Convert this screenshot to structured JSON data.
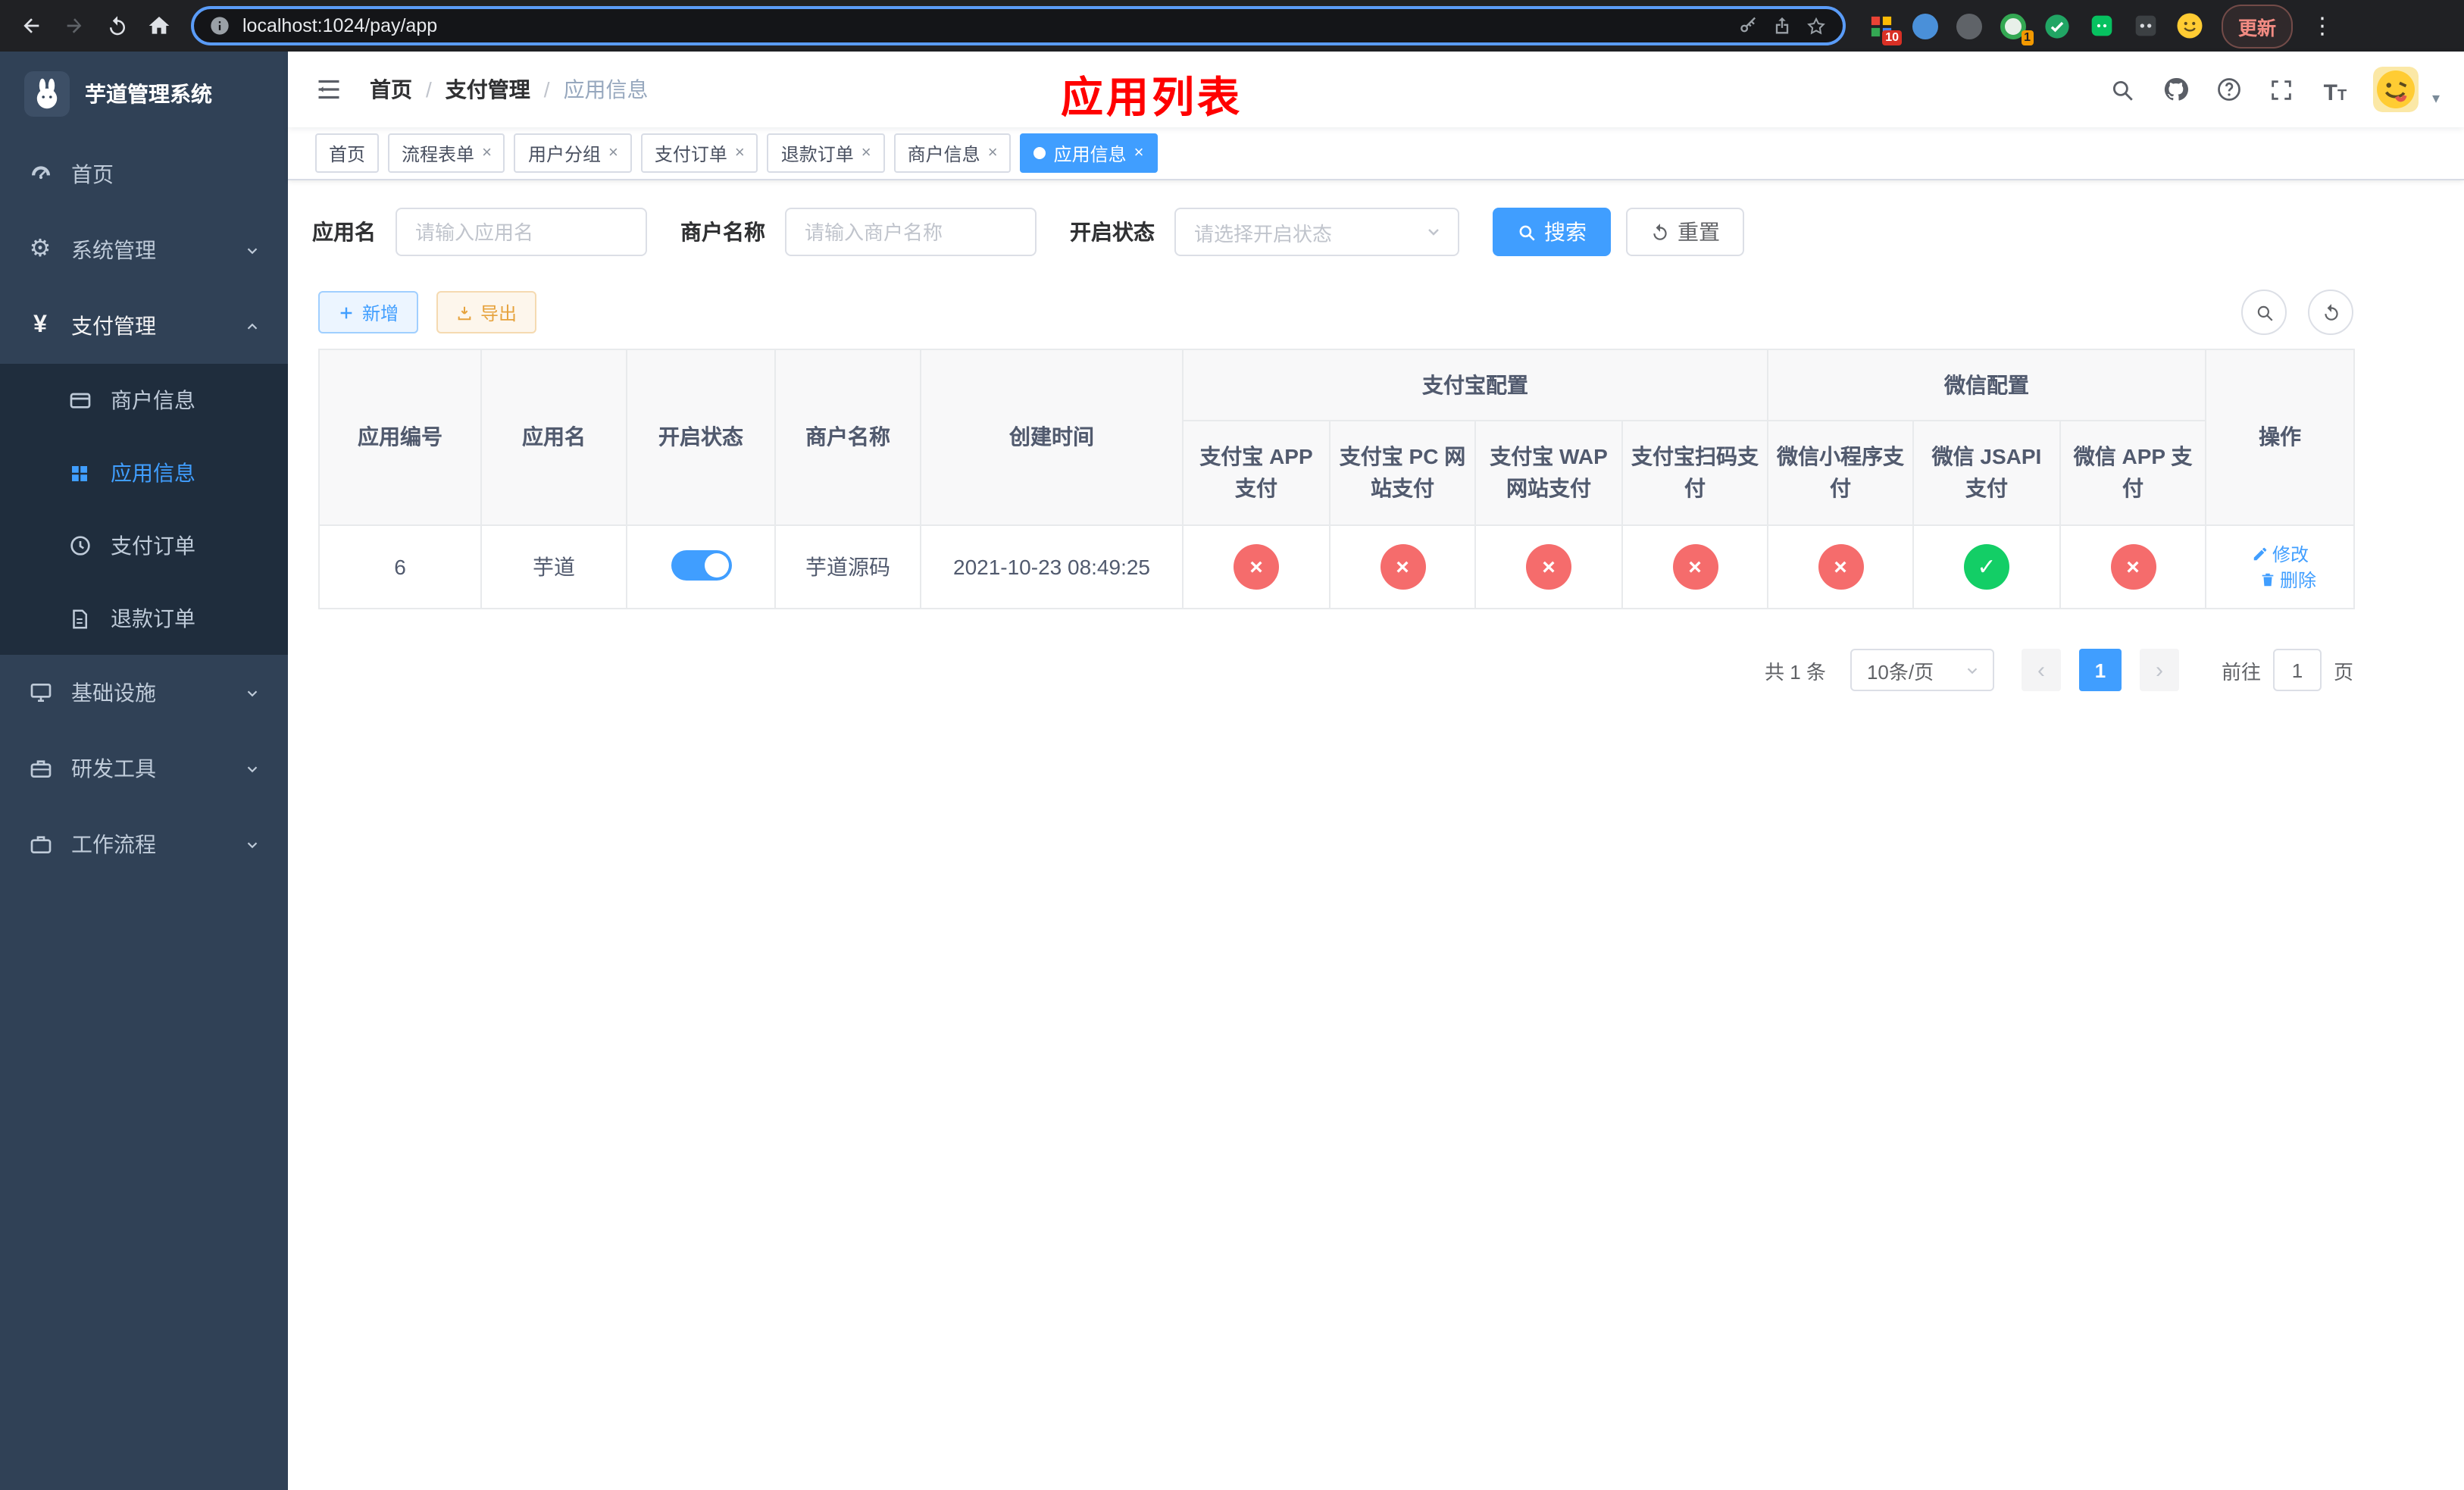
{
  "theme": {
    "accent": "#409eff",
    "danger": "#f56c6c",
    "success": "#13ce66",
    "warning": "#e6a23c",
    "sidebar_bg": "#304156",
    "submenu_bg": "#1f2d3d",
    "annotation_color": "#ff0000"
  },
  "browser": {
    "url": "localhost:1024/pay/app",
    "update_label": "更新",
    "extension_badge_a": "10",
    "extension_badge_b": "1"
  },
  "sidebar": {
    "title": "芋道管理系统",
    "items": [
      {
        "label": "首页"
      },
      {
        "label": "系统管理"
      },
      {
        "label": "支付管理"
      },
      {
        "label": "基础设施"
      },
      {
        "label": "研发工具"
      },
      {
        "label": "工作流程"
      }
    ],
    "payment_submenu": [
      {
        "label": "商户信息"
      },
      {
        "label": "应用信息"
      },
      {
        "label": "支付订单"
      },
      {
        "label": "退款订单"
      }
    ]
  },
  "header": {
    "breadcrumbs": [
      "首页",
      "支付管理",
      "应用信息"
    ],
    "annotation": "应用列表"
  },
  "tabs": [
    {
      "label": "首页"
    },
    {
      "label": "流程表单"
    },
    {
      "label": "用户分组"
    },
    {
      "label": "支付订单"
    },
    {
      "label": "退款订单"
    },
    {
      "label": "商户信息"
    },
    {
      "label": "应用信息"
    }
  ],
  "filters": {
    "app_name_label": "应用名",
    "app_name_placeholder": "请输入应用名",
    "merchant_label": "商户名称",
    "merchant_placeholder": "请输入商户名称",
    "status_label": "开启状态",
    "status_placeholder": "请选择开启状态",
    "search_label": "搜索",
    "reset_label": "重置"
  },
  "toolbar": {
    "add_label": "新增",
    "export_label": "导出"
  },
  "table": {
    "group_alipay": "支付宝配置",
    "group_wechat": "微信配置",
    "col_app_id": "应用编号",
    "col_app_name": "应用名",
    "col_status": "开启状态",
    "col_merchant": "商户名称",
    "col_created": "创建时间",
    "col_alipay_app": "支付宝 APP 支付",
    "col_alipay_pc": "支付宝 PC 网站支付",
    "col_alipay_wap": "支付宝 WAP 网站支付",
    "col_alipay_qr": "支付宝扫码支付",
    "col_wx_mini": "微信小程序支付",
    "col_wx_jsapi": "微信 JSAPI 支付",
    "col_wx_app": "微信 APP 支付",
    "col_actions": "操作",
    "rows": [
      {
        "app_id": "6",
        "app_name": "芋道",
        "enabled": true,
        "merchant": "芋道源码",
        "created": "2021-10-23 08:49:25",
        "alipay_app": false,
        "alipay_pc": false,
        "alipay_wap": false,
        "alipay_qr": false,
        "wx_mini": false,
        "wx_jsapi": true,
        "wx_app": false,
        "edit_label": "修改",
        "delete_label": "删除"
      }
    ]
  },
  "pagination": {
    "total": "共 1 条",
    "page_size": "10条/页",
    "current_page": "1",
    "goto_label": "前往",
    "goto_value": "1",
    "goto_suffix": "页"
  }
}
